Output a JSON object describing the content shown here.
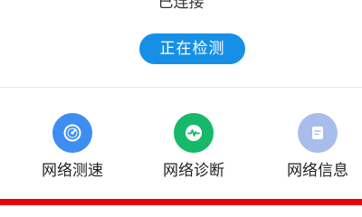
{
  "connection": {
    "status": "已连接"
  },
  "detect_button": {
    "label": "正在检测"
  },
  "tools": [
    {
      "label": "网络测速",
      "icon": "speedometer-icon",
      "color": "#3d8ef0"
    },
    {
      "label": "网络诊断",
      "icon": "pulse-icon",
      "color": "#16b86a"
    },
    {
      "label": "网络信息",
      "icon": "document-icon",
      "color": "#a9bdec"
    }
  ],
  "colors": {
    "accent": "#1690e6",
    "highlight_bar": "#e8000b"
  }
}
